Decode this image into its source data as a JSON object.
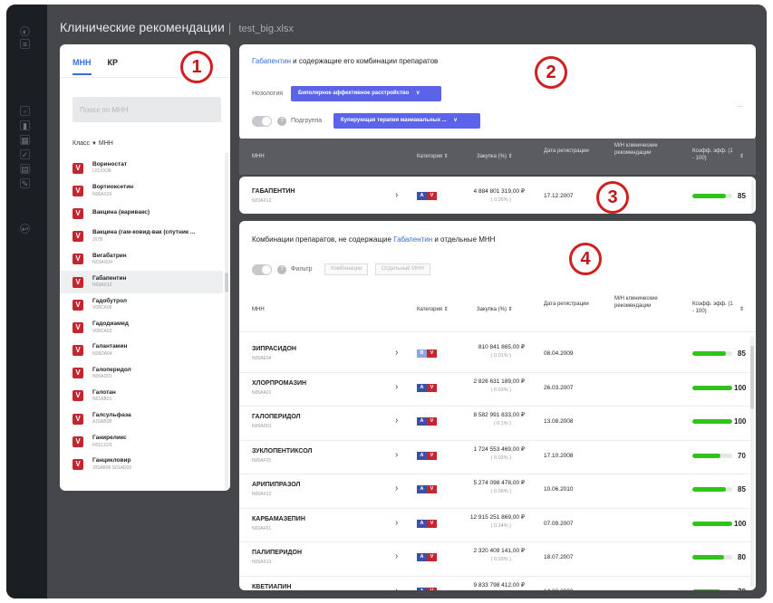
{
  "app": {
    "title": "Клинические рекомендации",
    "separator": "|",
    "file": "test_big.xlsx"
  },
  "rail_icons": [
    "logo-icon",
    "collapse-icon",
    "document-icon",
    "chart-icon",
    "calendar-icon",
    "file-check-icon",
    "table-icon",
    "edit-icon",
    "logout-icon"
  ],
  "left": {
    "tabs": [
      "МНН",
      "КР"
    ],
    "search_placeholder": "Поиск по МНН",
    "class_label": "Класс",
    "class_sort": "МНН",
    "items": [
      {
        "name": "Вориностат",
        "code": "L01XX38"
      },
      {
        "name": "Вортиоксетин",
        "code": "N06AX26"
      },
      {
        "name": "Вакцина (варивакс)",
        "code": ""
      },
      {
        "name": "Вакцина (гам-ковид-вак (спутник ...",
        "code": "J07B"
      },
      {
        "name": "Вигабатрин",
        "code": "N03AG04"
      },
      {
        "name": "Габапентин",
        "code": "N03AX12",
        "selected": true
      },
      {
        "name": "Гадобутрол",
        "code": "V08CA09"
      },
      {
        "name": "Гадодиамид",
        "code": "V08CA03"
      },
      {
        "name": "Галантамин",
        "code": "N06DA04"
      },
      {
        "name": "Галоперидол",
        "code": "N05AD01"
      },
      {
        "name": "Галотан",
        "code": "N01AB01"
      },
      {
        "name": "Галсульфаза",
        "code": "A16AB08"
      },
      {
        "name": "Ганиреликс",
        "code": "H01CC01"
      },
      {
        "name": "Ганцикловир",
        "code": "J05AB06 S01AD09"
      }
    ]
  },
  "card2": {
    "drug": "Габапентин",
    "title_rest": " и содержащие его комбинации препаратов",
    "nosology_label": "Нозология",
    "nosology_value": "Биполярное аффективное расстройство",
    "subgroup_label": "Подгруппа",
    "subgroup_value": "Купирующая терапия маниакальных ...",
    "more": "..."
  },
  "table_header": {
    "mnn": "МНН",
    "category": "Категория",
    "purchase": "Закупка (%)",
    "date": "Дата регистрации",
    "mh": "М/Н клинические рекомендации",
    "coef": "Коэфф. эфф. (1 - 100)"
  },
  "main_row": {
    "name": "ГАБАПЕНТИН",
    "code": "N03AX12",
    "cat": [
      "A",
      "V"
    ],
    "purchase": "4 884 801 319,00 ₽",
    "pct": "( 0.05% )",
    "date": "17.12.2007",
    "score": 85
  },
  "card4": {
    "title_pre": "Комбинации препаратов, не содержащие ",
    "drug": "Габапентин",
    "title_post": " и отдельные МНН",
    "filter_label": "Фильтр",
    "seg1": "Комбинации",
    "seg2": "Отдельный МНН"
  },
  "rows": [
    {
      "name": "ЗИПРАСИДОН",
      "code": "N05AE04",
      "cat": [
        "B",
        "V"
      ],
      "purchase": "810 841 865,00 ₽",
      "pct": "( 0.01% )",
      "date": "08.04.2009",
      "score": 85
    },
    {
      "name": "ХЛОРПРОМАЗИН",
      "code": "N05AA01",
      "cat": [
        "A",
        "V"
      ],
      "purchase": "2 826 631 189,00 ₽",
      "pct": "( 0.03% )",
      "date": "26.03.2007",
      "score": 100
    },
    {
      "name": "ГАЛОПЕРИДОЛ",
      "code": "N05AD01",
      "cat": [
        "A",
        "V"
      ],
      "purchase": "8 582 991 833,00 ₽",
      "pct": "( 0.1% )",
      "date": "13.08.2008",
      "score": 100
    },
    {
      "name": "ЗУКЛОПЕНТИКСОЛ",
      "code": "N05AF05",
      "cat": [
        "A",
        "V"
      ],
      "purchase": "1 724 553 469,00 ₽",
      "pct": "( 0.02% )",
      "date": "17.10.2008",
      "score": 70
    },
    {
      "name": "АРИПИПРАЗОЛ",
      "code": "N05AX12",
      "cat": [
        "A",
        "V"
      ],
      "purchase": "5 274 098 478,00 ₽",
      "pct": "( 0.06% )",
      "date": "10.06.2010",
      "score": 85
    },
    {
      "name": "КАРБАМАЗЕПИН",
      "code": "N03AF01",
      "cat": [
        "A",
        "V"
      ],
      "purchase": "12 915 251 869,00 ₽",
      "pct": "( 0.14% )",
      "date": "07.09.2007",
      "score": 100
    },
    {
      "name": "ПАЛИПЕРИДОН",
      "code": "N05AX13",
      "cat": [
        "A",
        "V"
      ],
      "purchase": "2 320 409 141,00 ₽",
      "pct": "( 0.03% )",
      "date": "18.07.2007",
      "score": 80
    },
    {
      "name": "КВЕТИАПИН",
      "code": "",
      "cat": [
        "A",
        "V"
      ],
      "purchase": "9 833 798 412,00 ₽",
      "pct": "",
      "date": "14.03.2008",
      "score": 70
    }
  ],
  "annotations": [
    "1",
    "2",
    "3",
    "4"
  ],
  "colors": {
    "accent": "#5b64e8",
    "link": "#3a6fd8",
    "badge_red": "#c3262f",
    "bar_green": "#2ec418",
    "annot_red": "#d11f1f"
  }
}
